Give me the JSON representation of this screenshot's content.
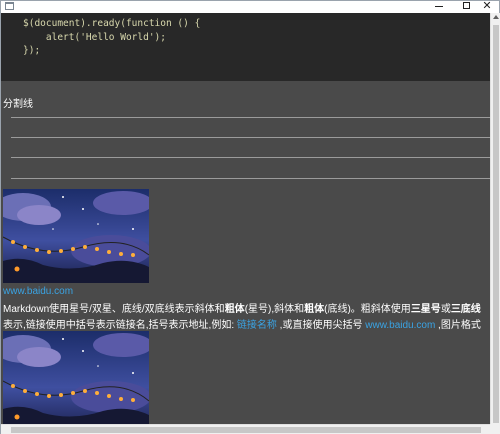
{
  "window": {
    "controls": {
      "minimize": "minimize",
      "maximize": "maximize",
      "close": "✕"
    }
  },
  "code_block": {
    "lines": [
      "$(document).ready(function () {",
      "    alert('Hello World');",
      "});"
    ]
  },
  "hr_section": {
    "title": "分割线"
  },
  "images": {
    "first_link": "www.baidu.com"
  },
  "paragraph": {
    "p1_a": "Markdown使用星号/双星、底线/双底线表示斜体和",
    "p1_bold1": "粗体",
    "p1_b": "(星号),斜体和",
    "p1_bold2": "粗体",
    "p1_c": "(底线)。粗斜体使用",
    "p1_bold3": "三星号",
    "p1_d": "或",
    "p1_bold4": "三底线",
    "p2_a": "表示,链接使用中括号表示链接名,括号表示地址,例如: ",
    "p2_link1": "链接名称",
    "p2_b": " ,或直接使用尖括号 ",
    "p2_link2": "www.baidu.com",
    "p2_c": " ,图片格式"
  },
  "colors": {
    "code_bg": "#282828",
    "content_bg": "#4a4a4a",
    "link": "#3aa3e3"
  }
}
